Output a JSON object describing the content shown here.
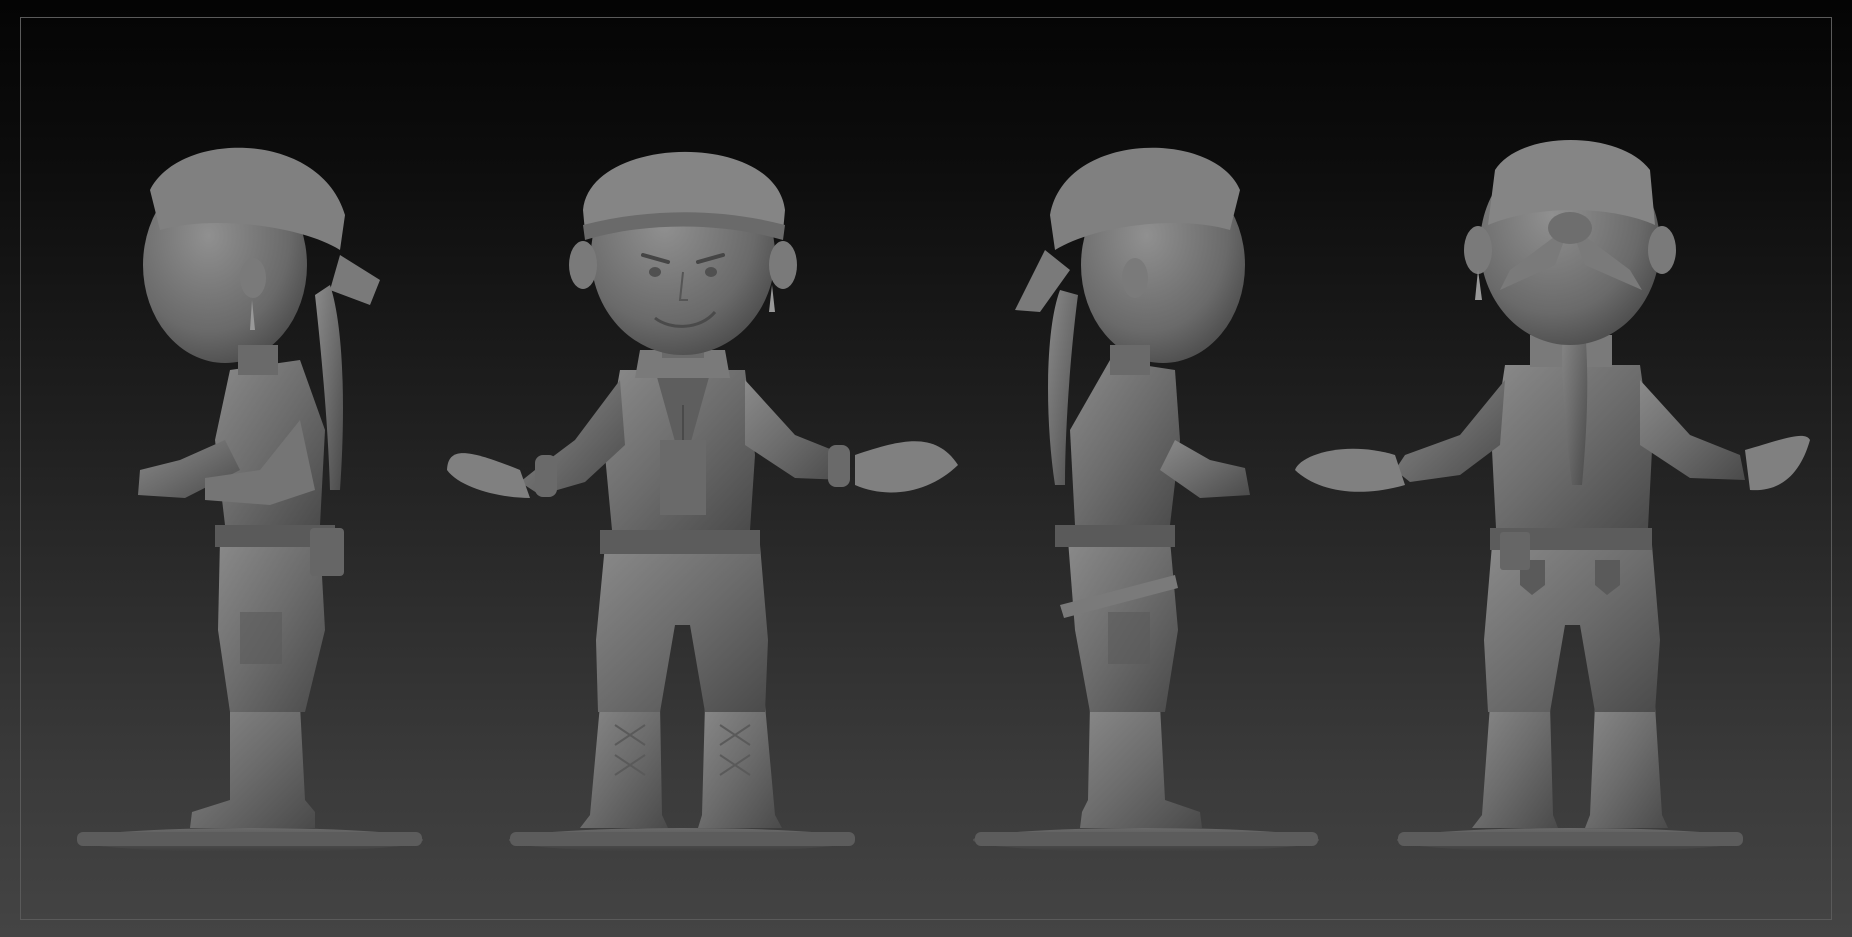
{
  "viewport": {
    "background_top": "#040404",
    "background_bottom": "#444444",
    "frame_color": "#5a5a5a",
    "model_color": "#6e6e6e"
  },
  "figures": [
    {
      "view": "left-side",
      "icon": "figure-side-left"
    },
    {
      "view": "front",
      "icon": "figure-front"
    },
    {
      "view": "right-side",
      "icon": "figure-side-right"
    },
    {
      "view": "back",
      "icon": "figure-back"
    }
  ]
}
